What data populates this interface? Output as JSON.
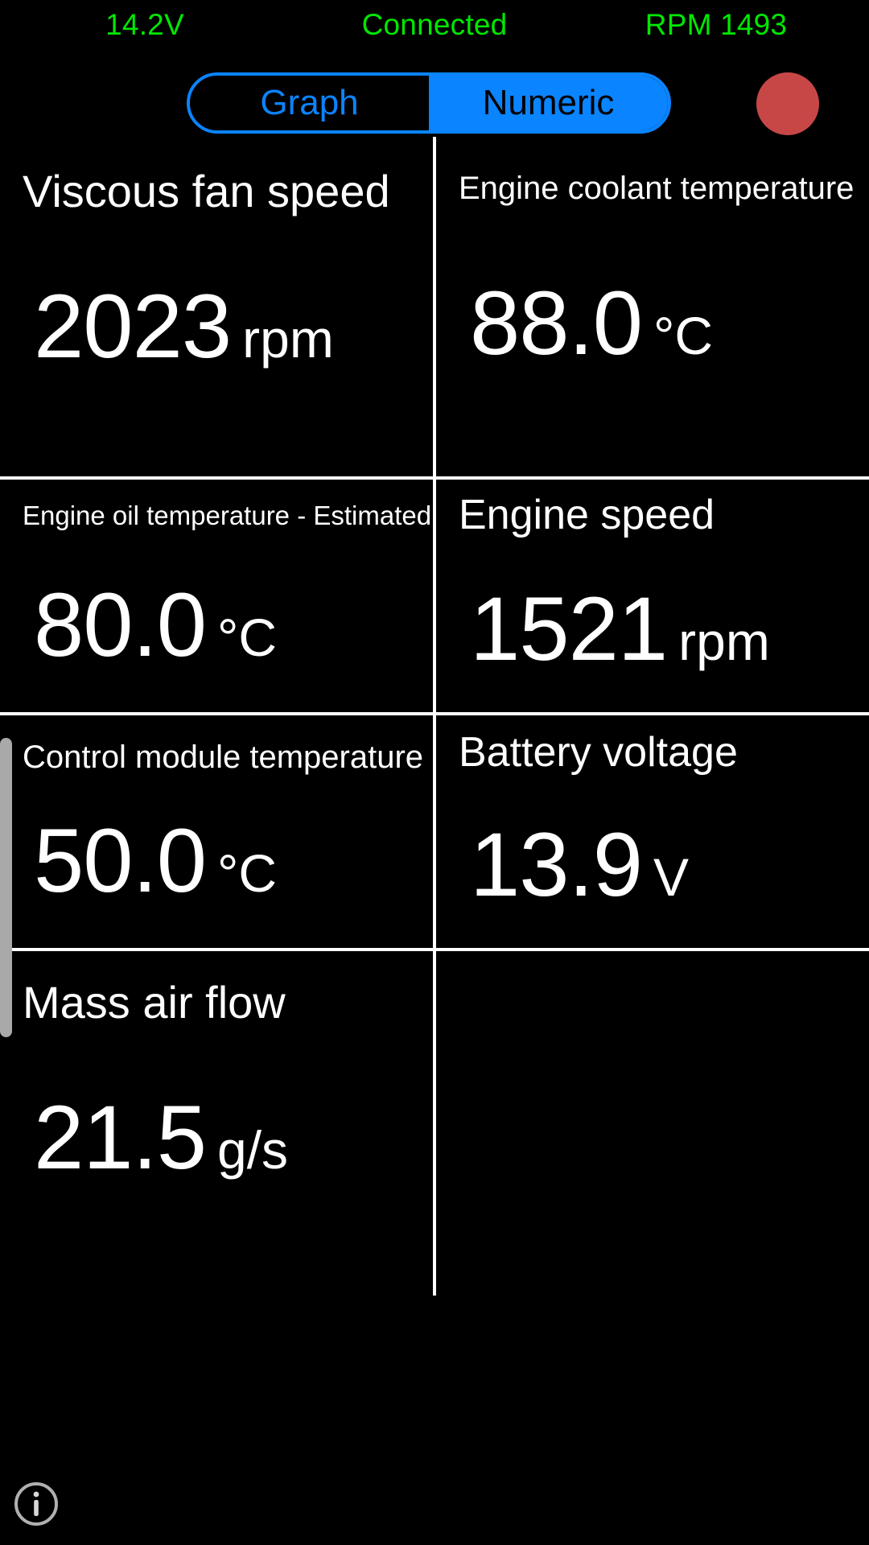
{
  "status_bar": {
    "voltage": "14.2V",
    "connection": "Connected",
    "rpm": "RPM 1493",
    "color": "#00E800"
  },
  "toolbar": {
    "mode_graph": "Graph",
    "mode_numeric": "Numeric",
    "selected_mode": "Numeric",
    "record_button_label": "",
    "accent_color": "#0A84FF",
    "record_color": "#C74747"
  },
  "gauges": [
    {
      "label": "Viscous fan speed",
      "value": "2023",
      "unit": "rpm"
    },
    {
      "label": "Engine coolant temperature",
      "value": "88.0",
      "unit": "°C"
    },
    {
      "label": "Engine oil temperature  -  Estimated",
      "value": "80.0",
      "unit": "°C"
    },
    {
      "label": "Engine speed",
      "value": "1521",
      "unit": "rpm"
    },
    {
      "label": "Control module temperature",
      "value": "50.0",
      "unit": "°C"
    },
    {
      "label": "Battery voltage",
      "value": "13.9",
      "unit": "V"
    },
    {
      "label": "Mass air flow",
      "value": "21.5",
      "unit": "g/s"
    },
    {
      "label": "",
      "value": "",
      "unit": ""
    }
  ],
  "icons": {
    "info": "info-icon",
    "record": "record-circle-icon",
    "scrollbar": "vertical-scrollbar"
  }
}
